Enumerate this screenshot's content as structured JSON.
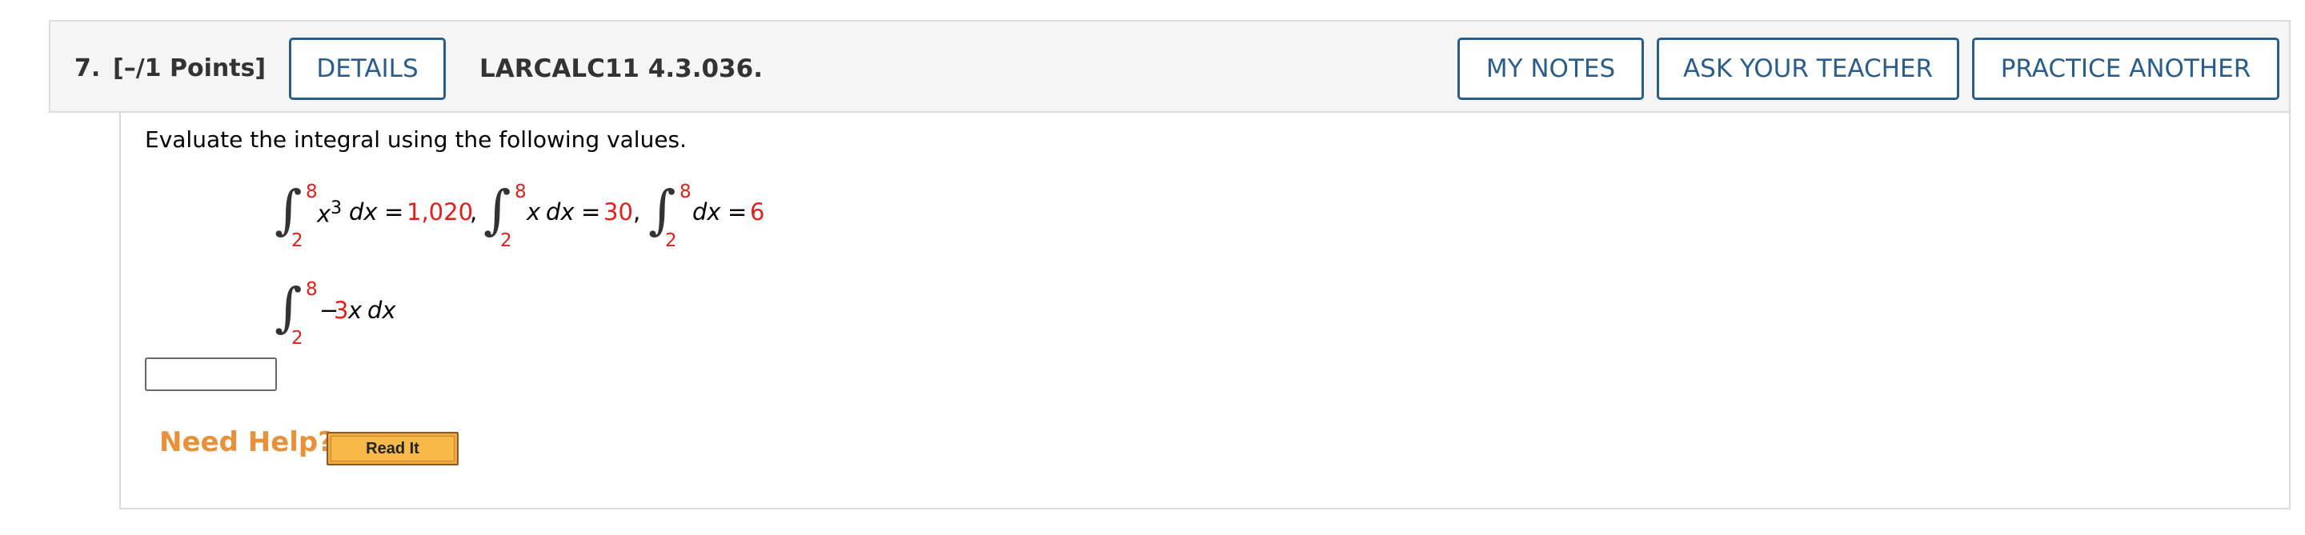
{
  "question": {
    "number": "7.",
    "points": "[–/1 Points]",
    "details_label": "DETAILS",
    "id": "LARCALC11 4.3.036.",
    "my_notes_label": "MY NOTES",
    "ask_teacher_label": "ASK YOUR TEACHER",
    "practice_another_label": "PRACTICE ANOTHER"
  },
  "content": {
    "instruction": "Evaluate the integral using the following values.",
    "given": [
      {
        "upper": "8",
        "lower": "2",
        "integrand_var": "x",
        "exponent": "3",
        "dx": "dx",
        "equals": "=",
        "value": "1,020",
        "sep": ","
      },
      {
        "upper": "8",
        "lower": "2",
        "integrand_var": "x",
        "dx": "dx",
        "equals": "=",
        "value": "30",
        "sep": ","
      },
      {
        "upper": "8",
        "lower": "2",
        "dx": "dx",
        "equals": "=",
        "value": "6"
      }
    ],
    "target": {
      "upper": "8",
      "lower": "2",
      "sign": "−",
      "coefficient": "3",
      "integrand_var": "x",
      "dx": "dx"
    },
    "answer_value": ""
  },
  "help": {
    "need_help_label": "Need Help?",
    "read_it_label": "Read It"
  },
  "colors": {
    "accent_blue": "#2a5d8a",
    "value_red": "#e0201b",
    "help_orange": "#e7913a",
    "button_yellow": "#f2a93c"
  }
}
